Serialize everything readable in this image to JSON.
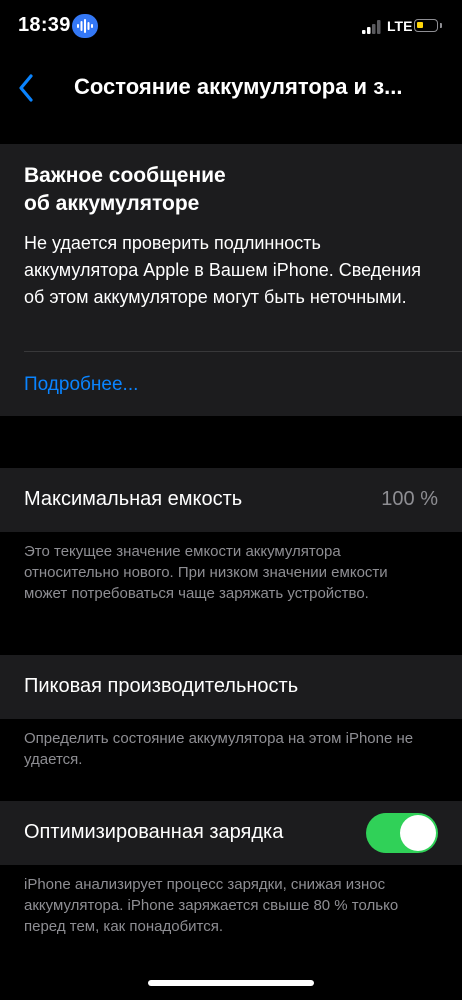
{
  "status_bar": {
    "time": "18:39",
    "network": "LTE"
  },
  "nav": {
    "title": "Состояние аккумулятора и з..."
  },
  "message": {
    "title_line1": "Важное сообщение",
    "title_line2": "об аккумуляторе",
    "body": "Не удается проверить подлинность аккумулятора Apple в Вашем iPhone. Сведения об этом аккумуляторе могут быть неточными.",
    "link": "Подробнее..."
  },
  "max_capacity": {
    "label": "Максимальная емкость",
    "value": "100 %",
    "footer": "Это текущее значение емкости аккумулятора относительно нового. При низком значении емкости может потребоваться чаще заряжать устройство."
  },
  "peak_performance": {
    "label": "Пиковая производительность",
    "footer": "Определить состояние аккумулятора на этом iPhone не удается."
  },
  "optimized_charging": {
    "label": "Оптимизированная зарядка",
    "enabled": true,
    "footer": "iPhone анализирует процесс зарядки, снижая износ аккумулятора. iPhone заряжается свыше 80 % только перед тем, как понадобится."
  },
  "colors": {
    "accent": "#0a84ff",
    "toggle_on": "#30d158",
    "battery_low": "#ffd60a",
    "card_bg": "#1c1c1e"
  }
}
